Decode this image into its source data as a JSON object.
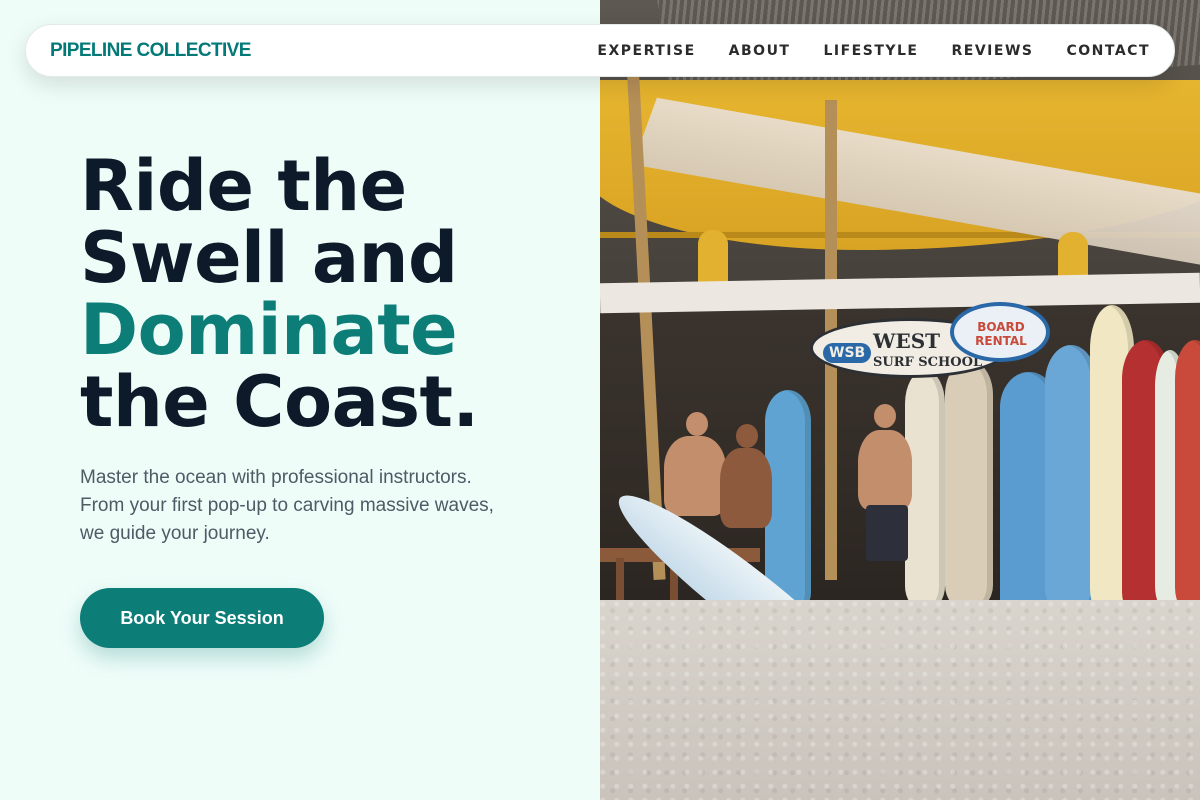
{
  "brand": {
    "name": "PIPELINE COLLECTIVE"
  },
  "nav": {
    "items": [
      {
        "label": "EXPERTISE"
      },
      {
        "label": "ABOUT"
      },
      {
        "label": "LIFESTYLE"
      },
      {
        "label": "REVIEWS"
      },
      {
        "label": "CONTACT"
      }
    ]
  },
  "hero": {
    "headline": {
      "line1": "Ride the",
      "line2": "Swell and",
      "accent": "Dominate",
      "line4": "the Coast."
    },
    "subtitle": "Master the ocean with professional instructors. From your first pop-up to carving massive waves, we guide your journey.",
    "cta_label": "Book Your Session",
    "image_signs": {
      "wsb": "WSB",
      "west": "WEST",
      "surf_school": "SURF SCHOOL",
      "board_rental": "BOARD RENTAL"
    }
  },
  "colors": {
    "accent": "#0c7d77",
    "brand": "#047a78",
    "background": "#effdf9",
    "heading": "#0d1a2a"
  }
}
